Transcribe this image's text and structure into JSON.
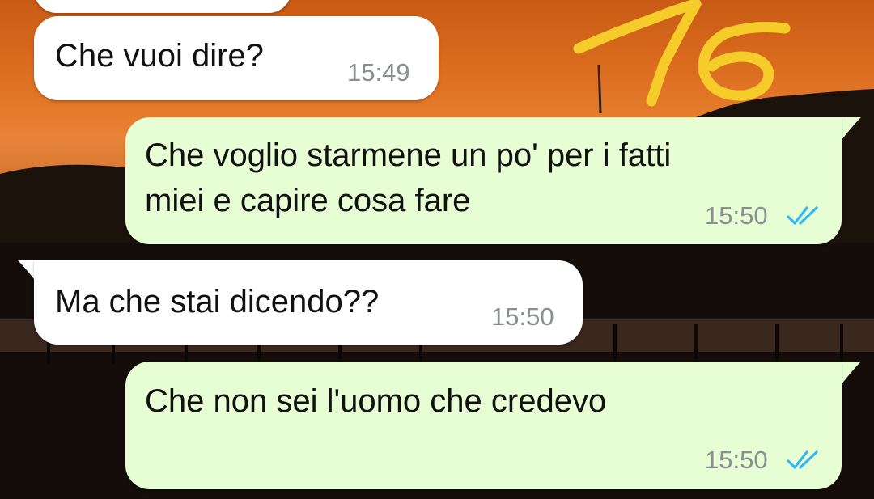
{
  "messages": [
    {
      "direction": "incoming",
      "text": "Che vuoi dire?",
      "time": "15:49"
    },
    {
      "direction": "outgoing",
      "lines": [
        "Che voglio starmene un po' per i fatti",
        "miei e capire cosa fare"
      ],
      "time": "15:50",
      "status": "read",
      "status_icon": "double-check-icon"
    },
    {
      "direction": "incoming",
      "text": "Ma che stai dicendo??",
      "time": "15:50"
    },
    {
      "direction": "outgoing",
      "text": "Che non sei l'uomo che credevo",
      "time": "15:50",
      "status": "read",
      "status_icon": "double-check-icon"
    }
  ],
  "overlay": {
    "handwritten_number": "16",
    "color": "#f5cc2a"
  },
  "colors": {
    "incoming_bubble": "#ffffff",
    "outgoing_bubble": "#e7fed4",
    "time_text": "#8a8f93",
    "read_ticks": "#34b7f1"
  }
}
